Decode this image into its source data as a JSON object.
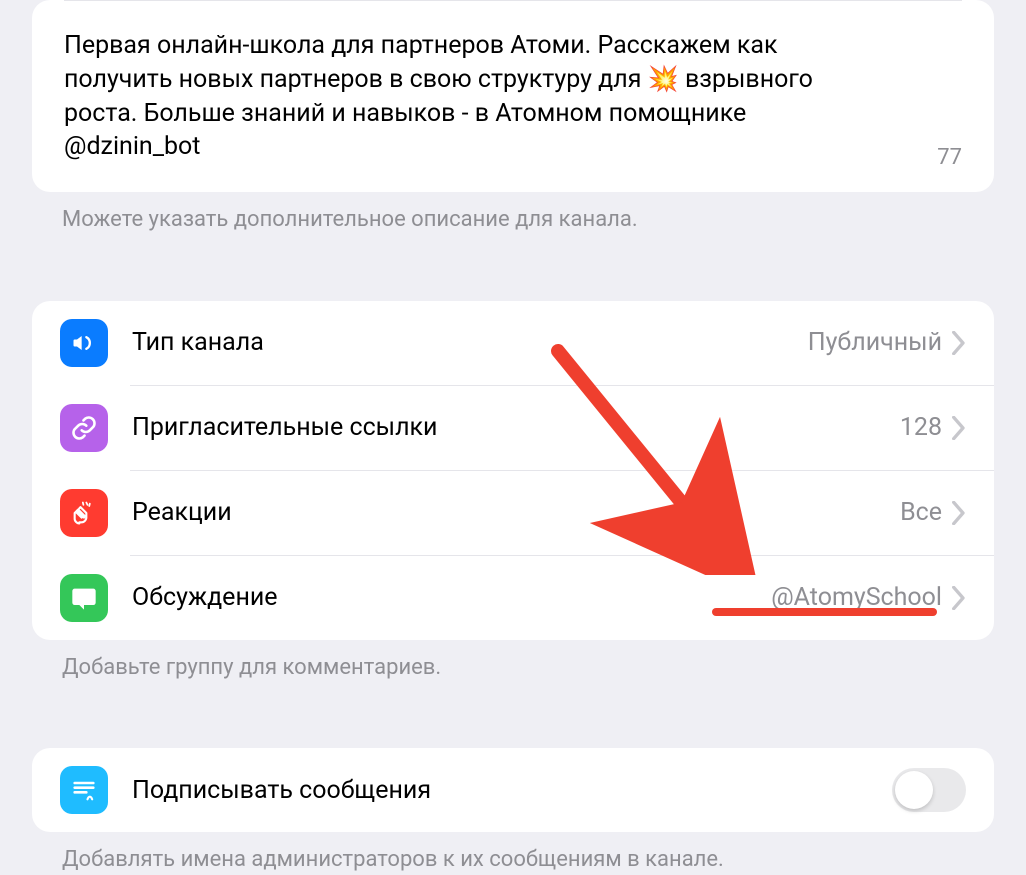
{
  "description": {
    "text": "Первая онлайн-школа для партнеров Атоми. Расскажем как получить новых партнеров в свою структуру для 💥 взрывного роста. Больше знаний и навыков - в Атомном помощнике @dzinin_bot",
    "counter": "77",
    "footer": "Можете указать дополнительное описание для канала."
  },
  "settings": {
    "channel_type": {
      "label": "Тип канала",
      "value": "Публичный"
    },
    "invite_links": {
      "label": "Пригласительные ссылки",
      "value": "128"
    },
    "reactions": {
      "label": "Реакции",
      "value": "Все"
    },
    "discussion": {
      "label": "Обсуждение",
      "value": "@AtomySchool"
    },
    "footer": "Добавьте группу для комментариев."
  },
  "sign_messages": {
    "label": "Подписывать сообщения",
    "enabled": false,
    "footer": "Добавлять имена администраторов к их сообщениям в канале."
  }
}
